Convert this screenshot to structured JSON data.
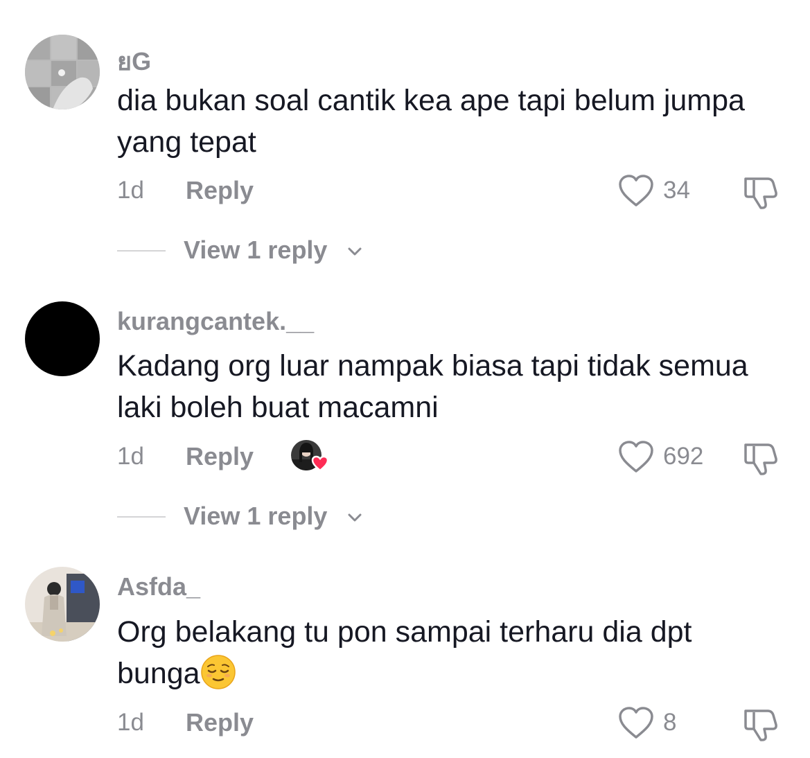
{
  "comments": [
    {
      "username": "ยG",
      "text": "dia bukan soal cantik kea ape tapi belum jumpa yang tepat",
      "time": "1d",
      "reply_label": "Reply",
      "like_count": "34",
      "view_replies": "View 1 reply",
      "avatar_icon": "photo-avatar-tiles"
    },
    {
      "username": "kurangcantek.__",
      "text": "Kadang org luar nampak biasa tapi tidak semua laki boleh buat macamni",
      "time": "1d",
      "reply_label": "Reply",
      "like_count": "692",
      "view_replies": "View 1 reply",
      "avatar_icon": "black-circle-avatar",
      "liked_by_creator": true
    },
    {
      "username": "Asfda_",
      "text": "Org belakang tu pon sampai terharu dia dpt bunga",
      "emoji": "relieved-face-emoji",
      "time": "1d",
      "reply_label": "Reply",
      "like_count": "8",
      "avatar_icon": "photo-avatar-person"
    }
  ],
  "colors": {
    "primary_text": "#161823",
    "secondary_text": "#8a8b91",
    "divider": "#d4d4d6",
    "heart_badge": "#fe2c55"
  }
}
